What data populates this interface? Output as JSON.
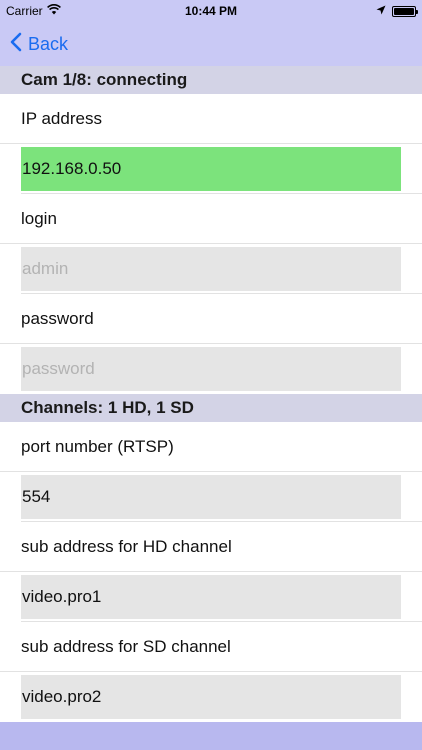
{
  "status_bar": {
    "carrier": "Carrier",
    "time": "10:44 PM"
  },
  "nav": {
    "back_label": "Back"
  },
  "sections": {
    "cam": {
      "title": "Cam 1/8: connecting"
    },
    "channels": {
      "title": "Channels: 1 HD, 1 SD"
    }
  },
  "fields": {
    "ip": {
      "label": "IP address",
      "value": "192.168.0.50",
      "state_color": "#7ce37c"
    },
    "login": {
      "label": "login",
      "placeholder": "admin"
    },
    "password": {
      "label": "password",
      "placeholder": "password"
    },
    "port": {
      "label": "port number (RTSP)",
      "value": "554"
    },
    "hd_sub": {
      "label": "sub address for HD channel",
      "value": "video.pro1"
    },
    "sd_sub": {
      "label": "sub address for SD channel",
      "value": "video.pro2"
    }
  },
  "icons": {
    "back": "chevron-left-icon",
    "wifi": "wifi-icon",
    "location": "location-arrow-icon",
    "battery": "battery-icon"
  },
  "colors": {
    "nav_background": "#c9c9f5",
    "section_background": "#d3d3e6",
    "tint": "#1a6cf0"
  }
}
